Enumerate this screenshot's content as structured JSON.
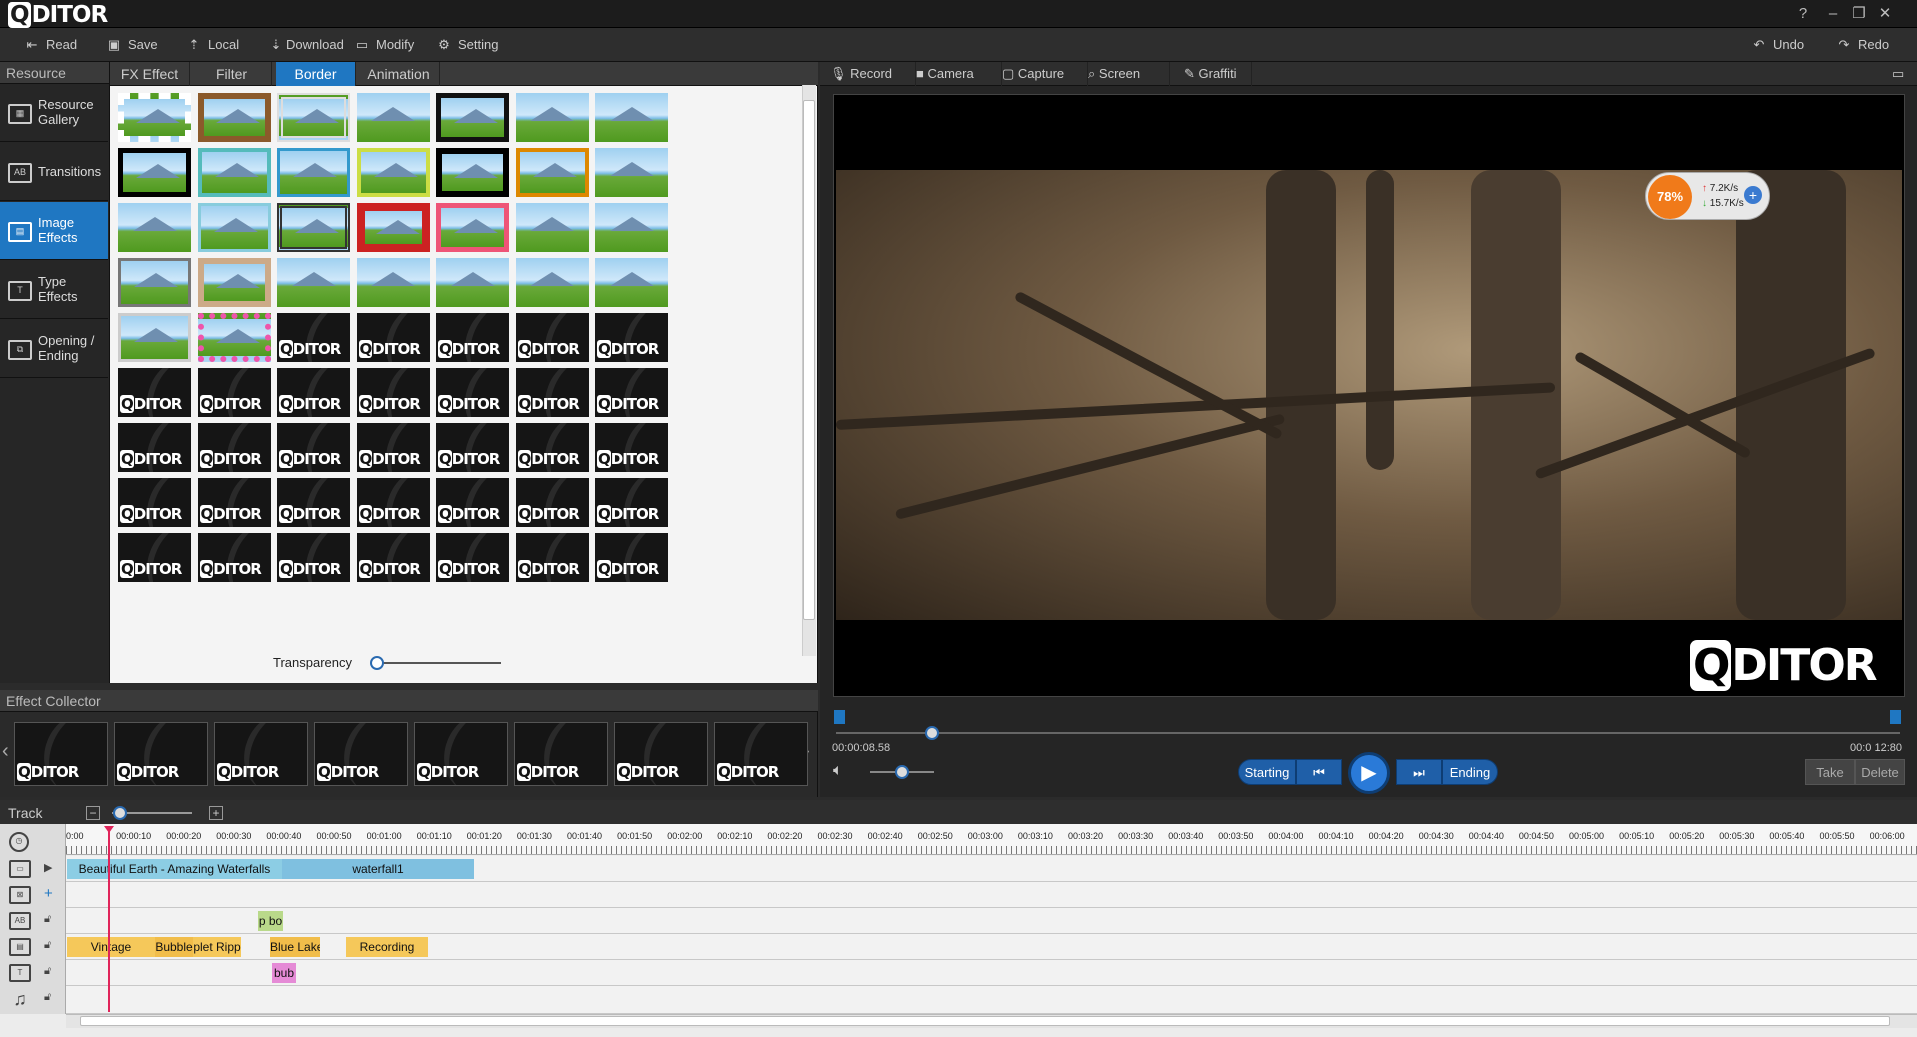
{
  "app": {
    "logo": "DITOR",
    "logo_q": "Q"
  },
  "window_controls": [
    "?",
    "–",
    "❐",
    "✕"
  ],
  "toolbar": {
    "read": "Read",
    "save": "Save",
    "local": "Local",
    "download": "Download",
    "modify": "Modify",
    "setting": "Setting",
    "undo": "Undo",
    "redo": "Redo"
  },
  "resource": {
    "header": "Resource",
    "items": [
      {
        "label": "Resource Gallery",
        "icon": "film-grid-icon"
      },
      {
        "label": "Transitions",
        "icon": "ab-transition-icon"
      },
      {
        "label": "Image Effects",
        "icon": "image-effects-icon",
        "active": true
      },
      {
        "label": "Type Effects",
        "icon": "text-effect-icon"
      },
      {
        "label": "Opening / Ending",
        "icon": "opening-ending-icon"
      }
    ]
  },
  "effect_tabs": [
    "FX Effect",
    "Filter",
    "Border",
    "Animation"
  ],
  "effect_tabs_active": "Border",
  "transparency_label": "Transparency",
  "collector": {
    "header": "Effect Collector",
    "count": 8,
    "watermark": "DITOR"
  },
  "preview_tabs": [
    "Record",
    "Camera",
    "Capture",
    "Screen",
    "Graffiti"
  ],
  "preview": {
    "watermark": "DITOR",
    "net_percent": "78%",
    "net_up": "7.2K/s",
    "net_down": "15.7K/s",
    "time_current": "00:00:08.58",
    "time_total": "00:0 12:80",
    "progress_fraction": 0.09
  },
  "controls": {
    "starting": "Starting",
    "ending": "Ending",
    "take": "Take",
    "delete": "Delete"
  },
  "timeline": {
    "label": "Track",
    "ruler": [
      "0:00",
      "00:00:10",
      "00:00:20",
      "00:00:30",
      "00:00:40",
      "00:00:50",
      "00:01:00",
      "00:01:10",
      "00:01:20",
      "00:01:30",
      "00:01:40",
      "00:01:50",
      "00:02:00",
      "00:02:10",
      "00:02:20",
      "00:02:30",
      "00:02:40",
      "00:02:50",
      "00:03:00",
      "00:03:10",
      "00:03:20",
      "00:03:30",
      "00:03:40",
      "00:03:50",
      "00:04:00",
      "00:04:10",
      "00:04:20",
      "00:04:30",
      "00:04:40",
      "00:04:50",
      "00:05:00",
      "00:05:10",
      "00:05:20",
      "00:05:30",
      "00:05:40",
      "00:05:50",
      "00:06:00"
    ],
    "clips": {
      "video1": "Beautiful Earth - Amazing Waterfalls",
      "video2": "waterfall1",
      "transition": "p bo",
      "fx1": "Vintage",
      "fx2": "Bubble",
      "fx3": "plet Ripp",
      "fx4": "Blue Lake",
      "fx5": "Recording",
      "text": "bub"
    }
  },
  "colors": {
    "accent": "#1f77c2",
    "clip_video": "#7fc6e0",
    "clip_fx": "#f5c85a",
    "clip_text": "#e58bd6",
    "clip_trans": "#b9d98a"
  }
}
